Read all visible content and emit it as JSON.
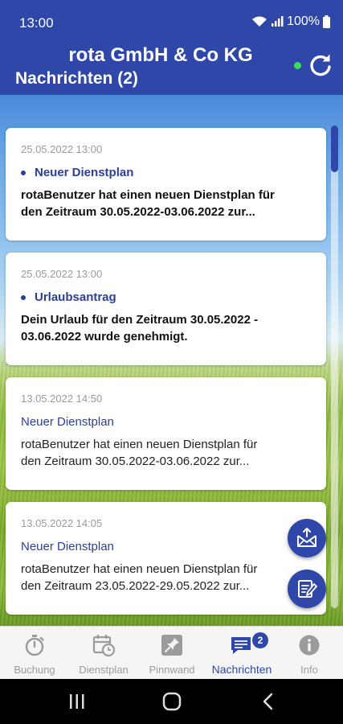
{
  "status_bar": {
    "time": "13:00",
    "battery": "100%",
    "icons": [
      "wifi-icon",
      "signal-icon",
      "battery-icon"
    ]
  },
  "header": {
    "company": "rota GmbH & Co KG",
    "title": "Nachrichten (2)",
    "online_status_color": "#3be05a",
    "refresh_icon": "refresh-icon"
  },
  "messages": [
    {
      "date": "25.05.2022 13:00",
      "subject": "Neuer Dienstplan",
      "body_line1": "rotaBenutzer hat einen neuen Dienstplan für",
      "body_line2": "den Zeitraum 30.05.2022-03.06.2022 zur...",
      "unread": true
    },
    {
      "date": "25.05.2022 13:00",
      "subject": "Urlaubsantrag",
      "body_line1": "Dein Urlaub für den Zeitraum 30.05.2022 -",
      "body_line2": "03.06.2022 wurde genehmigt.",
      "unread": true
    },
    {
      "date": "13.05.2022 14:50",
      "subject": "Neuer Dienstplan",
      "body_line1": "rotaBenutzer hat einen neuen Dienstplan für",
      "body_line2": "den Zeitraum 30.05.2022-03.06.2022 zur...",
      "unread": false
    },
    {
      "date": "13.05.2022 14:05",
      "subject": "Neuer Dienstplan",
      "body_line1": "rotaBenutzer hat einen neuen Dienstplan für",
      "body_line2": "den Zeitraum 23.05.2022-29.05.2022 zur...",
      "unread": false
    }
  ],
  "fabs": {
    "upper_icon": "mail-upload-icon",
    "lower_icon": "compose-icon"
  },
  "nav": {
    "items": [
      {
        "label": "Buchung",
        "icon": "stopwatch-icon"
      },
      {
        "label": "Dienstplan",
        "icon": "calendar-clock-icon"
      },
      {
        "label": "Pinnwand",
        "icon": "pushpin-icon"
      },
      {
        "label": "Nachrichten",
        "icon": "chat-icon",
        "badge": "2",
        "active": true
      },
      {
        "label": "Info",
        "icon": "info-icon"
      }
    ]
  },
  "system_nav": {
    "icons": [
      "recents-icon",
      "home-icon",
      "back-icon"
    ]
  },
  "colors": {
    "primary": "#2f47a8",
    "accent_text": "#2b3f97"
  }
}
